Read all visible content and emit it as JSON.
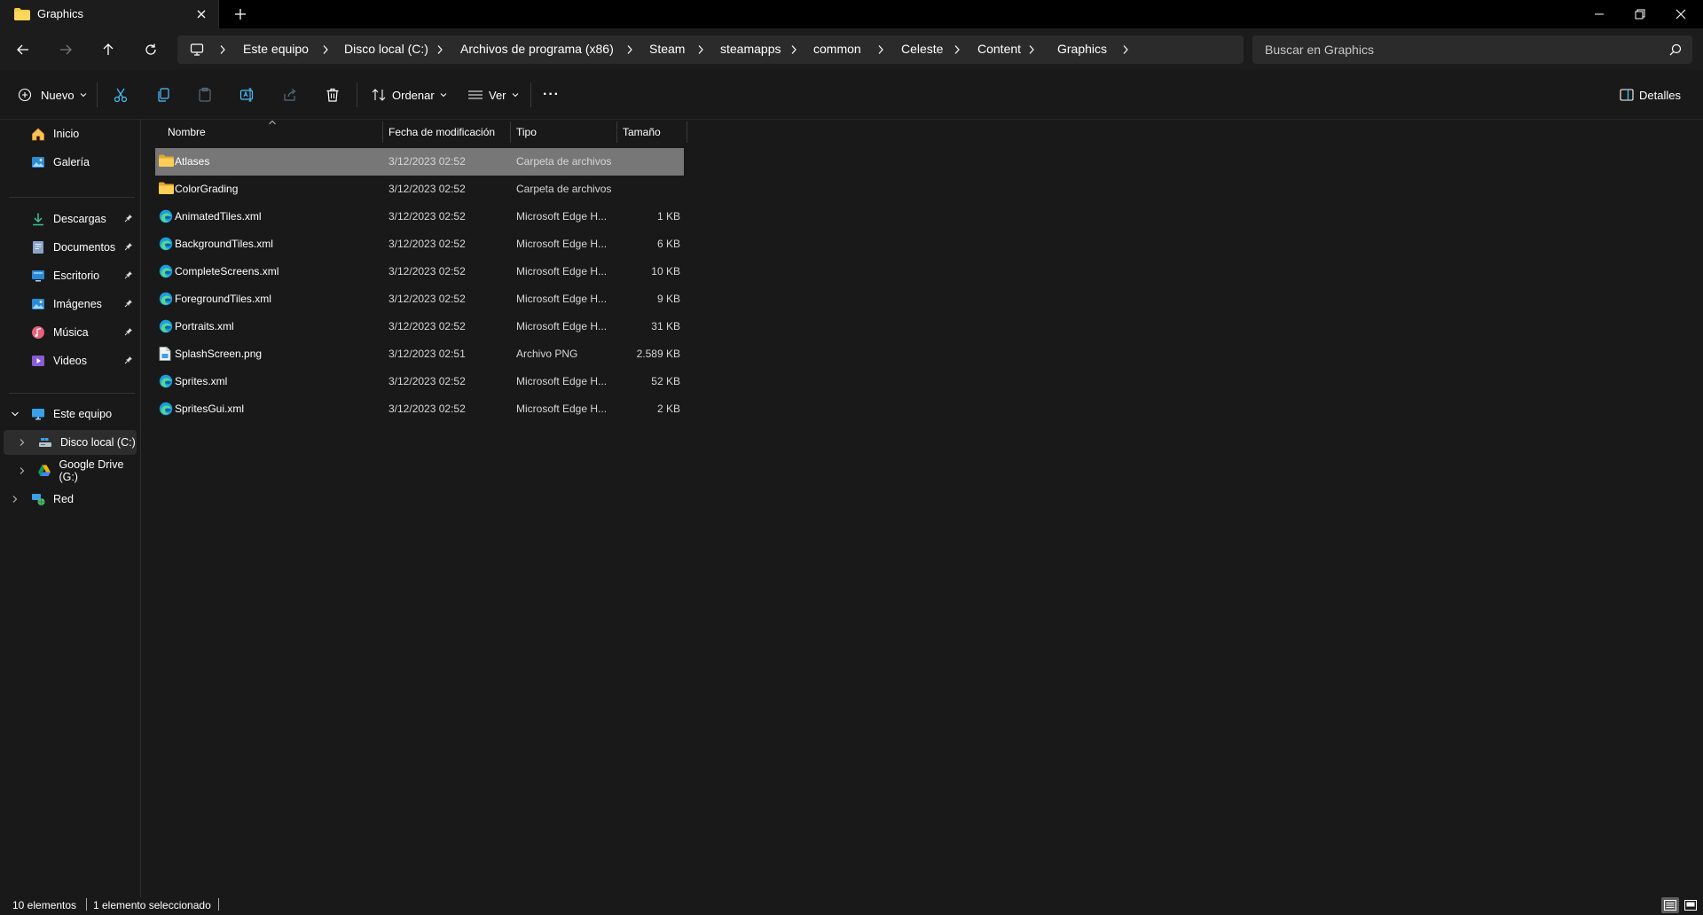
{
  "window": {
    "tab_title": "Graphics",
    "new_tab_glyph": "+"
  },
  "nav": {
    "breadcrumbs": [
      "Este equipo",
      "Disco local (C:)",
      "Archivos de programa (x86)",
      "Steam",
      "steamapps",
      "common",
      "Celeste",
      "Content",
      "Graphics"
    ],
    "search_placeholder": "Buscar en Graphics"
  },
  "toolbar": {
    "new_label": "Nuevo",
    "sort_label": "Ordenar",
    "view_label": "Ver",
    "more_label": "···",
    "details_label": "Detalles"
  },
  "sidebar": {
    "home": "Inicio",
    "gallery": "Galería",
    "quick": [
      {
        "label": "Descargas",
        "icon": "download-icon"
      },
      {
        "label": "Documentos",
        "icon": "documents-icon"
      },
      {
        "label": "Escritorio",
        "icon": "desktop-icon"
      },
      {
        "label": "Imágenes",
        "icon": "pictures-icon"
      },
      {
        "label": "Música",
        "icon": "music-icon"
      },
      {
        "label": "Videos",
        "icon": "videos-icon"
      }
    ],
    "this_pc": "Este equipo",
    "drive_c": "Disco local (C:)",
    "drive_g": "Google Drive (G:)",
    "network": "Red"
  },
  "columns": {
    "name": "Nombre",
    "modified": "Fecha de modificación",
    "type": "Tipo",
    "size": "Tamaño"
  },
  "files": [
    {
      "name": "Atlases",
      "modified": "3/12/2023 02:52",
      "type": "Carpeta de archivos",
      "size": "",
      "kind": "folder"
    },
    {
      "name": "ColorGrading",
      "modified": "3/12/2023 02:52",
      "type": "Carpeta de archivos",
      "size": "",
      "kind": "folder"
    },
    {
      "name": "AnimatedTiles.xml",
      "modified": "3/12/2023 02:52",
      "type": "Microsoft Edge H...",
      "size": "1 KB",
      "kind": "edge"
    },
    {
      "name": "BackgroundTiles.xml",
      "modified": "3/12/2023 02:52",
      "type": "Microsoft Edge H...",
      "size": "6 KB",
      "kind": "edge"
    },
    {
      "name": "CompleteScreens.xml",
      "modified": "3/12/2023 02:52",
      "type": "Microsoft Edge H...",
      "size": "10 KB",
      "kind": "edge"
    },
    {
      "name": "ForegroundTiles.xml",
      "modified": "3/12/2023 02:52",
      "type": "Microsoft Edge H...",
      "size": "9 KB",
      "kind": "edge"
    },
    {
      "name": "Portraits.xml",
      "modified": "3/12/2023 02:52",
      "type": "Microsoft Edge H...",
      "size": "31 KB",
      "kind": "edge"
    },
    {
      "name": "SplashScreen.png",
      "modified": "3/12/2023 02:51",
      "type": "Archivo PNG",
      "size": "2.589 KB",
      "kind": "png"
    },
    {
      "name": "Sprites.xml",
      "modified": "3/12/2023 02:52",
      "type": "Microsoft Edge H...",
      "size": "52 KB",
      "kind": "edge"
    },
    {
      "name": "SpritesGui.xml",
      "modified": "3/12/2023 02:52",
      "type": "Microsoft Edge H...",
      "size": "2 KB",
      "kind": "edge"
    }
  ],
  "status": {
    "count": "10 elementos",
    "selected": "1 elemento seleccionado"
  },
  "colors": {
    "accent": "#4cc2ff",
    "folder": "#f2c94c",
    "selection": "#777777"
  }
}
